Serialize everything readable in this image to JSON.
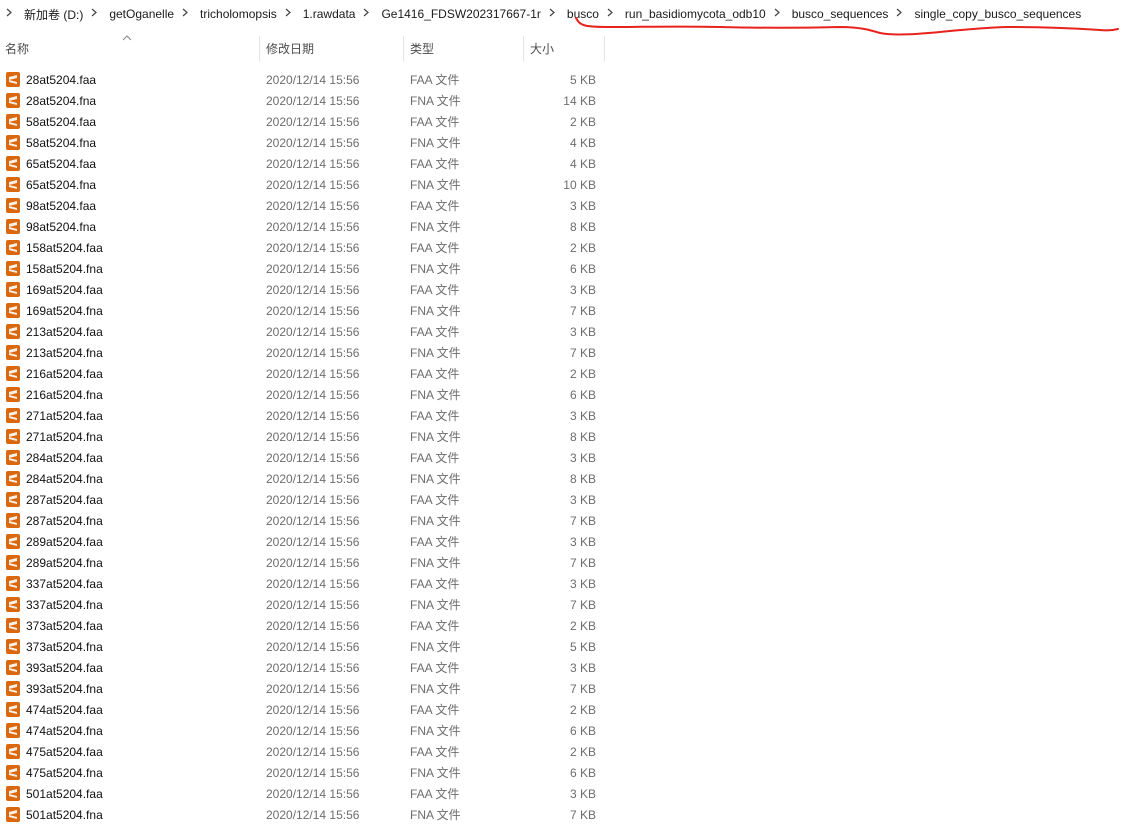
{
  "breadcrumb": [
    "新加卷 (D:)",
    "getOganelle",
    "tricholomopsis",
    "1.rawdata",
    "Ge1416_FDSW202317667-1r",
    "busco",
    "run_basidiomycota_odb10",
    "busco_sequences",
    "single_copy_busco_sequences"
  ],
  "columns": {
    "name": "名称",
    "date": "修改日期",
    "type": "类型",
    "size": "大小"
  },
  "icons": {
    "sort": "sort-up-icon",
    "separator": "chevron-right-icon",
    "file": "sublime-file-icon"
  },
  "colors": {
    "annotation": "#e8221c",
    "file_icon": "#d9680f"
  },
  "files": [
    {
      "name": "28at5204.faa",
      "date": "2020/12/14 15:56",
      "type": "FAA 文件",
      "size": "5 KB"
    },
    {
      "name": "28at5204.fna",
      "date": "2020/12/14 15:56",
      "type": "FNA 文件",
      "size": "14 KB"
    },
    {
      "name": "58at5204.faa",
      "date": "2020/12/14 15:56",
      "type": "FAA 文件",
      "size": "2 KB"
    },
    {
      "name": "58at5204.fna",
      "date": "2020/12/14 15:56",
      "type": "FNA 文件",
      "size": "4 KB"
    },
    {
      "name": "65at5204.faa",
      "date": "2020/12/14 15:56",
      "type": "FAA 文件",
      "size": "4 KB"
    },
    {
      "name": "65at5204.fna",
      "date": "2020/12/14 15:56",
      "type": "FNA 文件",
      "size": "10 KB"
    },
    {
      "name": "98at5204.faa",
      "date": "2020/12/14 15:56",
      "type": "FAA 文件",
      "size": "3 KB"
    },
    {
      "name": "98at5204.fna",
      "date": "2020/12/14 15:56",
      "type": "FNA 文件",
      "size": "8 KB"
    },
    {
      "name": "158at5204.faa",
      "date": "2020/12/14 15:56",
      "type": "FAA 文件",
      "size": "2 KB"
    },
    {
      "name": "158at5204.fna",
      "date": "2020/12/14 15:56",
      "type": "FNA 文件",
      "size": "6 KB"
    },
    {
      "name": "169at5204.faa",
      "date": "2020/12/14 15:56",
      "type": "FAA 文件",
      "size": "3 KB"
    },
    {
      "name": "169at5204.fna",
      "date": "2020/12/14 15:56",
      "type": "FNA 文件",
      "size": "7 KB"
    },
    {
      "name": "213at5204.faa",
      "date": "2020/12/14 15:56",
      "type": "FAA 文件",
      "size": "3 KB"
    },
    {
      "name": "213at5204.fna",
      "date": "2020/12/14 15:56",
      "type": "FNA 文件",
      "size": "7 KB"
    },
    {
      "name": "216at5204.faa",
      "date": "2020/12/14 15:56",
      "type": "FAA 文件",
      "size": "2 KB"
    },
    {
      "name": "216at5204.fna",
      "date": "2020/12/14 15:56",
      "type": "FNA 文件",
      "size": "6 KB"
    },
    {
      "name": "271at5204.faa",
      "date": "2020/12/14 15:56",
      "type": "FAA 文件",
      "size": "3 KB"
    },
    {
      "name": "271at5204.fna",
      "date": "2020/12/14 15:56",
      "type": "FNA 文件",
      "size": "8 KB"
    },
    {
      "name": "284at5204.faa",
      "date": "2020/12/14 15:56",
      "type": "FAA 文件",
      "size": "3 KB"
    },
    {
      "name": "284at5204.fna",
      "date": "2020/12/14 15:56",
      "type": "FNA 文件",
      "size": "8 KB"
    },
    {
      "name": "287at5204.faa",
      "date": "2020/12/14 15:56",
      "type": "FAA 文件",
      "size": "3 KB"
    },
    {
      "name": "287at5204.fna",
      "date": "2020/12/14 15:56",
      "type": "FNA 文件",
      "size": "7 KB"
    },
    {
      "name": "289at5204.faa",
      "date": "2020/12/14 15:56",
      "type": "FAA 文件",
      "size": "3 KB"
    },
    {
      "name": "289at5204.fna",
      "date": "2020/12/14 15:56",
      "type": "FNA 文件",
      "size": "7 KB"
    },
    {
      "name": "337at5204.faa",
      "date": "2020/12/14 15:56",
      "type": "FAA 文件",
      "size": "3 KB"
    },
    {
      "name": "337at5204.fna",
      "date": "2020/12/14 15:56",
      "type": "FNA 文件",
      "size": "7 KB"
    },
    {
      "name": "373at5204.faa",
      "date": "2020/12/14 15:56",
      "type": "FAA 文件",
      "size": "2 KB"
    },
    {
      "name": "373at5204.fna",
      "date": "2020/12/14 15:56",
      "type": "FNA 文件",
      "size": "5 KB"
    },
    {
      "name": "393at5204.faa",
      "date": "2020/12/14 15:56",
      "type": "FAA 文件",
      "size": "3 KB"
    },
    {
      "name": "393at5204.fna",
      "date": "2020/12/14 15:56",
      "type": "FNA 文件",
      "size": "7 KB"
    },
    {
      "name": "474at5204.faa",
      "date": "2020/12/14 15:56",
      "type": "FAA 文件",
      "size": "2 KB"
    },
    {
      "name": "474at5204.fna",
      "date": "2020/12/14 15:56",
      "type": "FNA 文件",
      "size": "6 KB"
    },
    {
      "name": "475at5204.faa",
      "date": "2020/12/14 15:56",
      "type": "FAA 文件",
      "size": "2 KB"
    },
    {
      "name": "475at5204.fna",
      "date": "2020/12/14 15:56",
      "type": "FNA 文件",
      "size": "6 KB"
    },
    {
      "name": "501at5204.faa",
      "date": "2020/12/14 15:56",
      "type": "FAA 文件",
      "size": "3 KB"
    },
    {
      "name": "501at5204.fna",
      "date": "2020/12/14 15:56",
      "type": "FNA 文件",
      "size": "7 KB"
    }
  ]
}
